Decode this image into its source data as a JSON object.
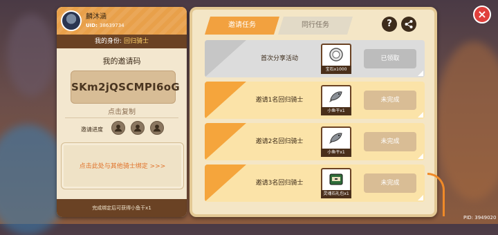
{
  "player": {
    "name": "麟沐涵",
    "uid_label": "UID:",
    "uid": "38639734",
    "identity_label": "我的身份:",
    "identity_value": "回归骑士"
  },
  "invite": {
    "code_label": "我的邀请码",
    "code": "SKm2jQSCMPI6oG",
    "copy_label": "点击复制",
    "progress_label": "邀请进度",
    "progress_slots_filled": 0,
    "progress_slots_total": 3,
    "bind_prompt": "点击此处与其他骑士绑定 >>>",
    "bind_footer": "完成绑定后可获得小鱼干x1"
  },
  "tabs": [
    {
      "label": "邀请任务",
      "active": true
    },
    {
      "label": "同行任务",
      "active": false
    }
  ],
  "buttons": {
    "help": "?",
    "close": "×"
  },
  "tasks": [
    {
      "name": "首次分享活动",
      "reward_label": "宝石x1000",
      "reward_icon": "gem-icon",
      "status": "已领取",
      "state": "claimed"
    },
    {
      "name": "邀请1名回归骑士",
      "reward_label": "小鱼干x1",
      "reward_icon": "fish-icon",
      "status": "未完成",
      "state": "todo"
    },
    {
      "name": "邀请2名回归骑士",
      "reward_label": "小鱼干x1",
      "reward_icon": "fish-icon",
      "status": "未完成",
      "state": "todo"
    },
    {
      "name": "邀请3名回归骑士",
      "reward_label": "灵魂石礼包x1",
      "reward_icon": "chest-icon",
      "status": "未完成",
      "state": "todo"
    }
  ],
  "footer": {
    "pid": "PID: 3949020"
  },
  "colors": {
    "accent": "#f2a13f",
    "brown": "#6a4224",
    "close": "#e0403c"
  }
}
